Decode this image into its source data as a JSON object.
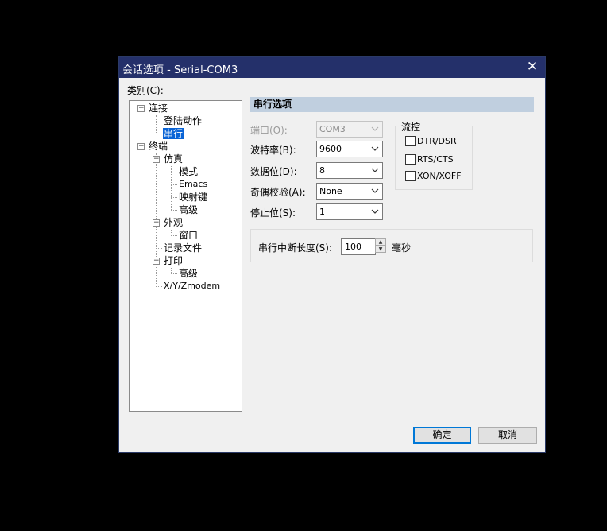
{
  "window": {
    "title": "会话选项 - Serial-COM3"
  },
  "category_label": "类别(C):",
  "tree": {
    "items": [
      {
        "label": "连接"
      },
      {
        "label": "登陆动作"
      },
      {
        "label": "串行"
      },
      {
        "label": "终端"
      },
      {
        "label": "仿真"
      },
      {
        "label": "模式"
      },
      {
        "label": "Emacs"
      },
      {
        "label": "映射键"
      },
      {
        "label": "高级"
      },
      {
        "label": "外观"
      },
      {
        "label": "窗口"
      },
      {
        "label": "记录文件"
      },
      {
        "label": "打印"
      },
      {
        "label": "高级"
      },
      {
        "label": "X/Y/Zmodem"
      }
    ],
    "selected": "串行"
  },
  "section_title": "串行选项",
  "fields": {
    "port": {
      "label": "端口(O):",
      "value": "COM3"
    },
    "baud": {
      "label": "波特率(B):",
      "value": "9600"
    },
    "databits": {
      "label": "数据位(D):",
      "value": "8"
    },
    "parity": {
      "label": "奇偶校验(A):",
      "value": "None"
    },
    "stopbits": {
      "label": "停止位(S):",
      "value": "1"
    }
  },
  "flow": {
    "title": "流控",
    "options": [
      {
        "label": "DTR/DSR",
        "checked": false
      },
      {
        "label": "RTS/CTS",
        "checked": false
      },
      {
        "label": "XON/XOFF",
        "checked": false
      }
    ]
  },
  "break_length": {
    "label": "串行中断长度(S):",
    "value": "100",
    "unit": "毫秒"
  },
  "buttons": {
    "ok": "确定",
    "cancel": "取消"
  },
  "icons": {
    "close": "close-icon",
    "dropdown": "chevron-down-icon",
    "expand": "minus-box-icon"
  },
  "colors": {
    "titlebar": "#24306a",
    "selection": "#0a64d6",
    "section_header": "#c0cfdf",
    "default_button_border": "#0078d7"
  }
}
